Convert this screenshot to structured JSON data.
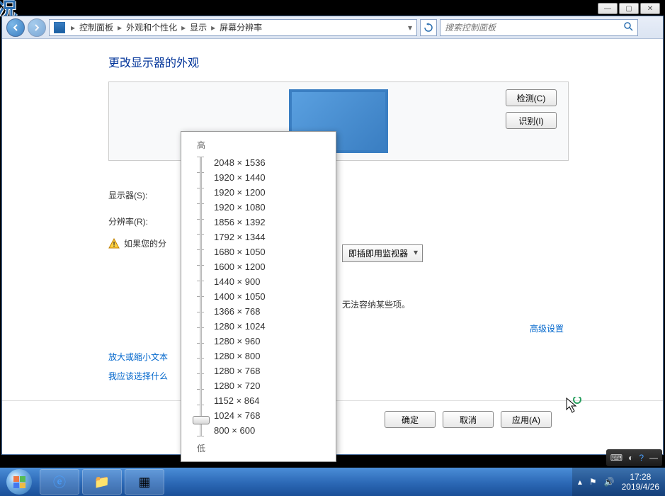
{
  "window_controls": {
    "minimize": "—",
    "maximize": "▢",
    "close": "✕"
  },
  "breadcrumb": {
    "items": [
      "控制面板",
      "外观和个性化",
      "显示",
      "屏幕分辨率"
    ]
  },
  "search": {
    "placeholder": "搜索控制面板"
  },
  "page": {
    "title": "更改显示器的外观",
    "detect_btn": "检测(C)",
    "identify_btn": "识别(I)",
    "display_label": "显示器(S):",
    "resolution_label": "分辨率(R):",
    "monitor_select": "即插即用监视器",
    "warning_prefix": "如果您的分",
    "warning_suffix": "无法容纳某些项。",
    "advanced_link": "高级设置",
    "links": [
      "放大或缩小文本",
      "我应该选择什么"
    ],
    "ok_btn": "确定",
    "cancel_btn": "取消",
    "apply_btn": "应用(A)"
  },
  "resolution_popup": {
    "high_label": "高",
    "low_label": "低",
    "options": [
      "2048 × 1536",
      "1920 × 1440",
      "1920 × 1200",
      "1920 × 1080",
      "1856 × 1392",
      "1792 × 1344",
      "1680 × 1050",
      "1600 × 1200",
      "1440 × 900",
      "1400 × 1050",
      "1366 × 768",
      "1280 × 1024",
      "1280 × 960",
      "1280 × 800",
      "1280 × 768",
      "1280 × 720",
      "1152 × 864",
      "1024 × 768",
      "800 × 600"
    ],
    "selected_index": 15
  },
  "taskbar": {
    "time": "17:28",
    "date": "2019/4/26"
  }
}
